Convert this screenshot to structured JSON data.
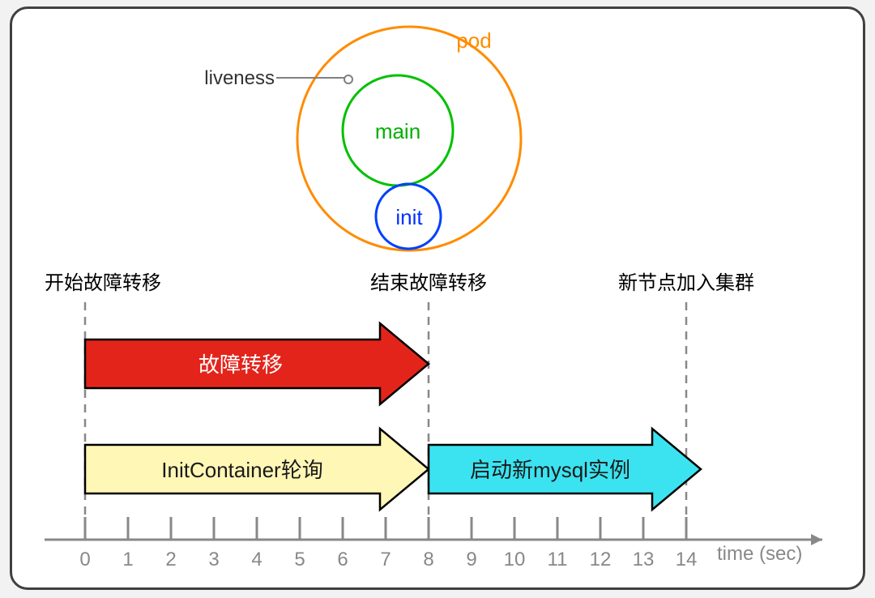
{
  "pod_diagram": {
    "pod_label": "pod",
    "main_label": "main",
    "init_label": "init",
    "liveness_label": "liveness"
  },
  "events": {
    "start_failover": "开始故障转移",
    "end_failover": "结束故障转移",
    "new_node_joins": "新节点加入集群"
  },
  "arrows": {
    "failover": "故障转移",
    "initcontainer_poll": "InitContainer轮询",
    "start_new_mysql": "启动新mysql实例"
  },
  "axis": {
    "label": "time (sec)",
    "ticks": [
      "0",
      "1",
      "2",
      "3",
      "4",
      "5",
      "6",
      "7",
      "8",
      "9",
      "10",
      "11",
      "12",
      "13",
      "14"
    ]
  },
  "chart_data": {
    "type": "timeline",
    "title": "",
    "xlabel": "time (sec)",
    "ylabel": "",
    "ylim": [
      0,
      14
    ],
    "events": [
      {
        "name": "开始故障转移",
        "t": 0
      },
      {
        "name": "结束故障转移",
        "t": 8
      },
      {
        "name": "新节点加入集群",
        "t": 14
      }
    ],
    "spans": [
      {
        "name": "故障转移",
        "start": 0,
        "end": 8,
        "color": "#e3241b"
      },
      {
        "name": "InitContainer轮询",
        "start": 0,
        "end": 8,
        "color": "#fff7b6"
      },
      {
        "name": "启动新mysql实例",
        "start": 8,
        "end": 14,
        "color": "#3be3f0"
      }
    ],
    "pod_structure": {
      "pod": {
        "contains": [
          "main",
          "init"
        ]
      },
      "liveness_points_to": "main"
    }
  }
}
